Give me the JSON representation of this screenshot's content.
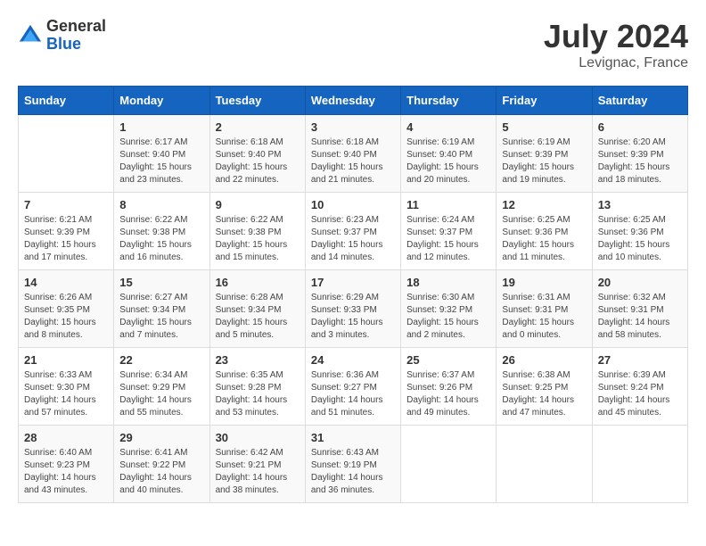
{
  "header": {
    "logo_general": "General",
    "logo_blue": "Blue",
    "month_year": "July 2024",
    "location": "Levignac, France"
  },
  "days_of_week": [
    "Sunday",
    "Monday",
    "Tuesday",
    "Wednesday",
    "Thursday",
    "Friday",
    "Saturday"
  ],
  "weeks": [
    [
      {
        "day": "",
        "info": ""
      },
      {
        "day": "1",
        "info": "Sunrise: 6:17 AM\nSunset: 9:40 PM\nDaylight: 15 hours\nand 23 minutes."
      },
      {
        "day": "2",
        "info": "Sunrise: 6:18 AM\nSunset: 9:40 PM\nDaylight: 15 hours\nand 22 minutes."
      },
      {
        "day": "3",
        "info": "Sunrise: 6:18 AM\nSunset: 9:40 PM\nDaylight: 15 hours\nand 21 minutes."
      },
      {
        "day": "4",
        "info": "Sunrise: 6:19 AM\nSunset: 9:40 PM\nDaylight: 15 hours\nand 20 minutes."
      },
      {
        "day": "5",
        "info": "Sunrise: 6:19 AM\nSunset: 9:39 PM\nDaylight: 15 hours\nand 19 minutes."
      },
      {
        "day": "6",
        "info": "Sunrise: 6:20 AM\nSunset: 9:39 PM\nDaylight: 15 hours\nand 18 minutes."
      }
    ],
    [
      {
        "day": "7",
        "info": "Sunrise: 6:21 AM\nSunset: 9:39 PM\nDaylight: 15 hours\nand 17 minutes."
      },
      {
        "day": "8",
        "info": "Sunrise: 6:22 AM\nSunset: 9:38 PM\nDaylight: 15 hours\nand 16 minutes."
      },
      {
        "day": "9",
        "info": "Sunrise: 6:22 AM\nSunset: 9:38 PM\nDaylight: 15 hours\nand 15 minutes."
      },
      {
        "day": "10",
        "info": "Sunrise: 6:23 AM\nSunset: 9:37 PM\nDaylight: 15 hours\nand 14 minutes."
      },
      {
        "day": "11",
        "info": "Sunrise: 6:24 AM\nSunset: 9:37 PM\nDaylight: 15 hours\nand 12 minutes."
      },
      {
        "day": "12",
        "info": "Sunrise: 6:25 AM\nSunset: 9:36 PM\nDaylight: 15 hours\nand 11 minutes."
      },
      {
        "day": "13",
        "info": "Sunrise: 6:25 AM\nSunset: 9:36 PM\nDaylight: 15 hours\nand 10 minutes."
      }
    ],
    [
      {
        "day": "14",
        "info": "Sunrise: 6:26 AM\nSunset: 9:35 PM\nDaylight: 15 hours\nand 8 minutes."
      },
      {
        "day": "15",
        "info": "Sunrise: 6:27 AM\nSunset: 9:34 PM\nDaylight: 15 hours\nand 7 minutes."
      },
      {
        "day": "16",
        "info": "Sunrise: 6:28 AM\nSunset: 9:34 PM\nDaylight: 15 hours\nand 5 minutes."
      },
      {
        "day": "17",
        "info": "Sunrise: 6:29 AM\nSunset: 9:33 PM\nDaylight: 15 hours\nand 3 minutes."
      },
      {
        "day": "18",
        "info": "Sunrise: 6:30 AM\nSunset: 9:32 PM\nDaylight: 15 hours\nand 2 minutes."
      },
      {
        "day": "19",
        "info": "Sunrise: 6:31 AM\nSunset: 9:31 PM\nDaylight: 15 hours\nand 0 minutes."
      },
      {
        "day": "20",
        "info": "Sunrise: 6:32 AM\nSunset: 9:31 PM\nDaylight: 14 hours\nand 58 minutes."
      }
    ],
    [
      {
        "day": "21",
        "info": "Sunrise: 6:33 AM\nSunset: 9:30 PM\nDaylight: 14 hours\nand 57 minutes."
      },
      {
        "day": "22",
        "info": "Sunrise: 6:34 AM\nSunset: 9:29 PM\nDaylight: 14 hours\nand 55 minutes."
      },
      {
        "day": "23",
        "info": "Sunrise: 6:35 AM\nSunset: 9:28 PM\nDaylight: 14 hours\nand 53 minutes."
      },
      {
        "day": "24",
        "info": "Sunrise: 6:36 AM\nSunset: 9:27 PM\nDaylight: 14 hours\nand 51 minutes."
      },
      {
        "day": "25",
        "info": "Sunrise: 6:37 AM\nSunset: 9:26 PM\nDaylight: 14 hours\nand 49 minutes."
      },
      {
        "day": "26",
        "info": "Sunrise: 6:38 AM\nSunset: 9:25 PM\nDaylight: 14 hours\nand 47 minutes."
      },
      {
        "day": "27",
        "info": "Sunrise: 6:39 AM\nSunset: 9:24 PM\nDaylight: 14 hours\nand 45 minutes."
      }
    ],
    [
      {
        "day": "28",
        "info": "Sunrise: 6:40 AM\nSunset: 9:23 PM\nDaylight: 14 hours\nand 43 minutes."
      },
      {
        "day": "29",
        "info": "Sunrise: 6:41 AM\nSunset: 9:22 PM\nDaylight: 14 hours\nand 40 minutes."
      },
      {
        "day": "30",
        "info": "Sunrise: 6:42 AM\nSunset: 9:21 PM\nDaylight: 14 hours\nand 38 minutes."
      },
      {
        "day": "31",
        "info": "Sunrise: 6:43 AM\nSunset: 9:19 PM\nDaylight: 14 hours\nand 36 minutes."
      },
      {
        "day": "",
        "info": ""
      },
      {
        "day": "",
        "info": ""
      },
      {
        "day": "",
        "info": ""
      }
    ]
  ]
}
